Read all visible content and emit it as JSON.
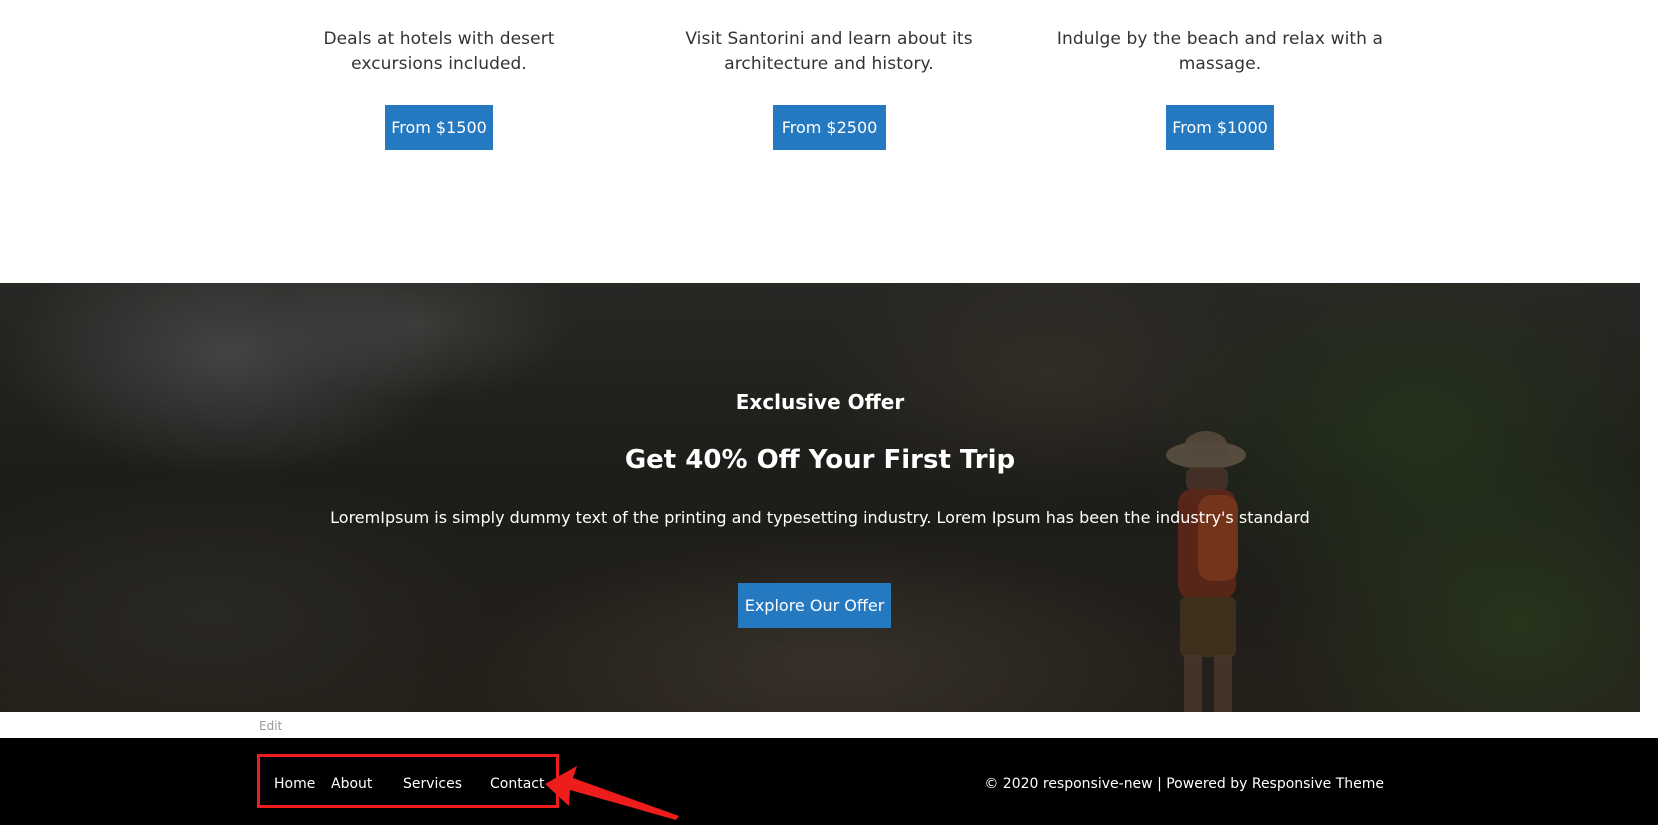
{
  "cards": [
    {
      "description": "Deals at hotels with desert excursions included.",
      "price_label": "From $1500"
    },
    {
      "description": "Visit Santorini and learn about its architecture and history.",
      "price_label": "From $2500"
    },
    {
      "description": "Indulge by the beach and relax with a massage.",
      "price_label": "From $1000"
    }
  ],
  "hero": {
    "eyebrow": "Exclusive Offer",
    "title": "Get 40% Off Your First Trip",
    "text": "LoremIpsum is simply dummy text of the printing and typesetting industry. Lorem Ipsum has been the industry's standard",
    "button_label": "Explore Our Offer"
  },
  "edit_label": "Edit",
  "footer": {
    "nav": [
      {
        "label": "Home"
      },
      {
        "label": "About"
      },
      {
        "label": "Services"
      },
      {
        "label": "Contact"
      }
    ],
    "copyright_prefix": "© 2020 responsive-new | Powered by",
    "theme_link": "Responsive Theme"
  },
  "colors": {
    "button_blue": "#2579c1",
    "annotation_red": "#ef1c1c",
    "footer_background": "#000000"
  },
  "annotation": {
    "type": "highlight-box-with-arrow",
    "target": "footer-nav"
  }
}
